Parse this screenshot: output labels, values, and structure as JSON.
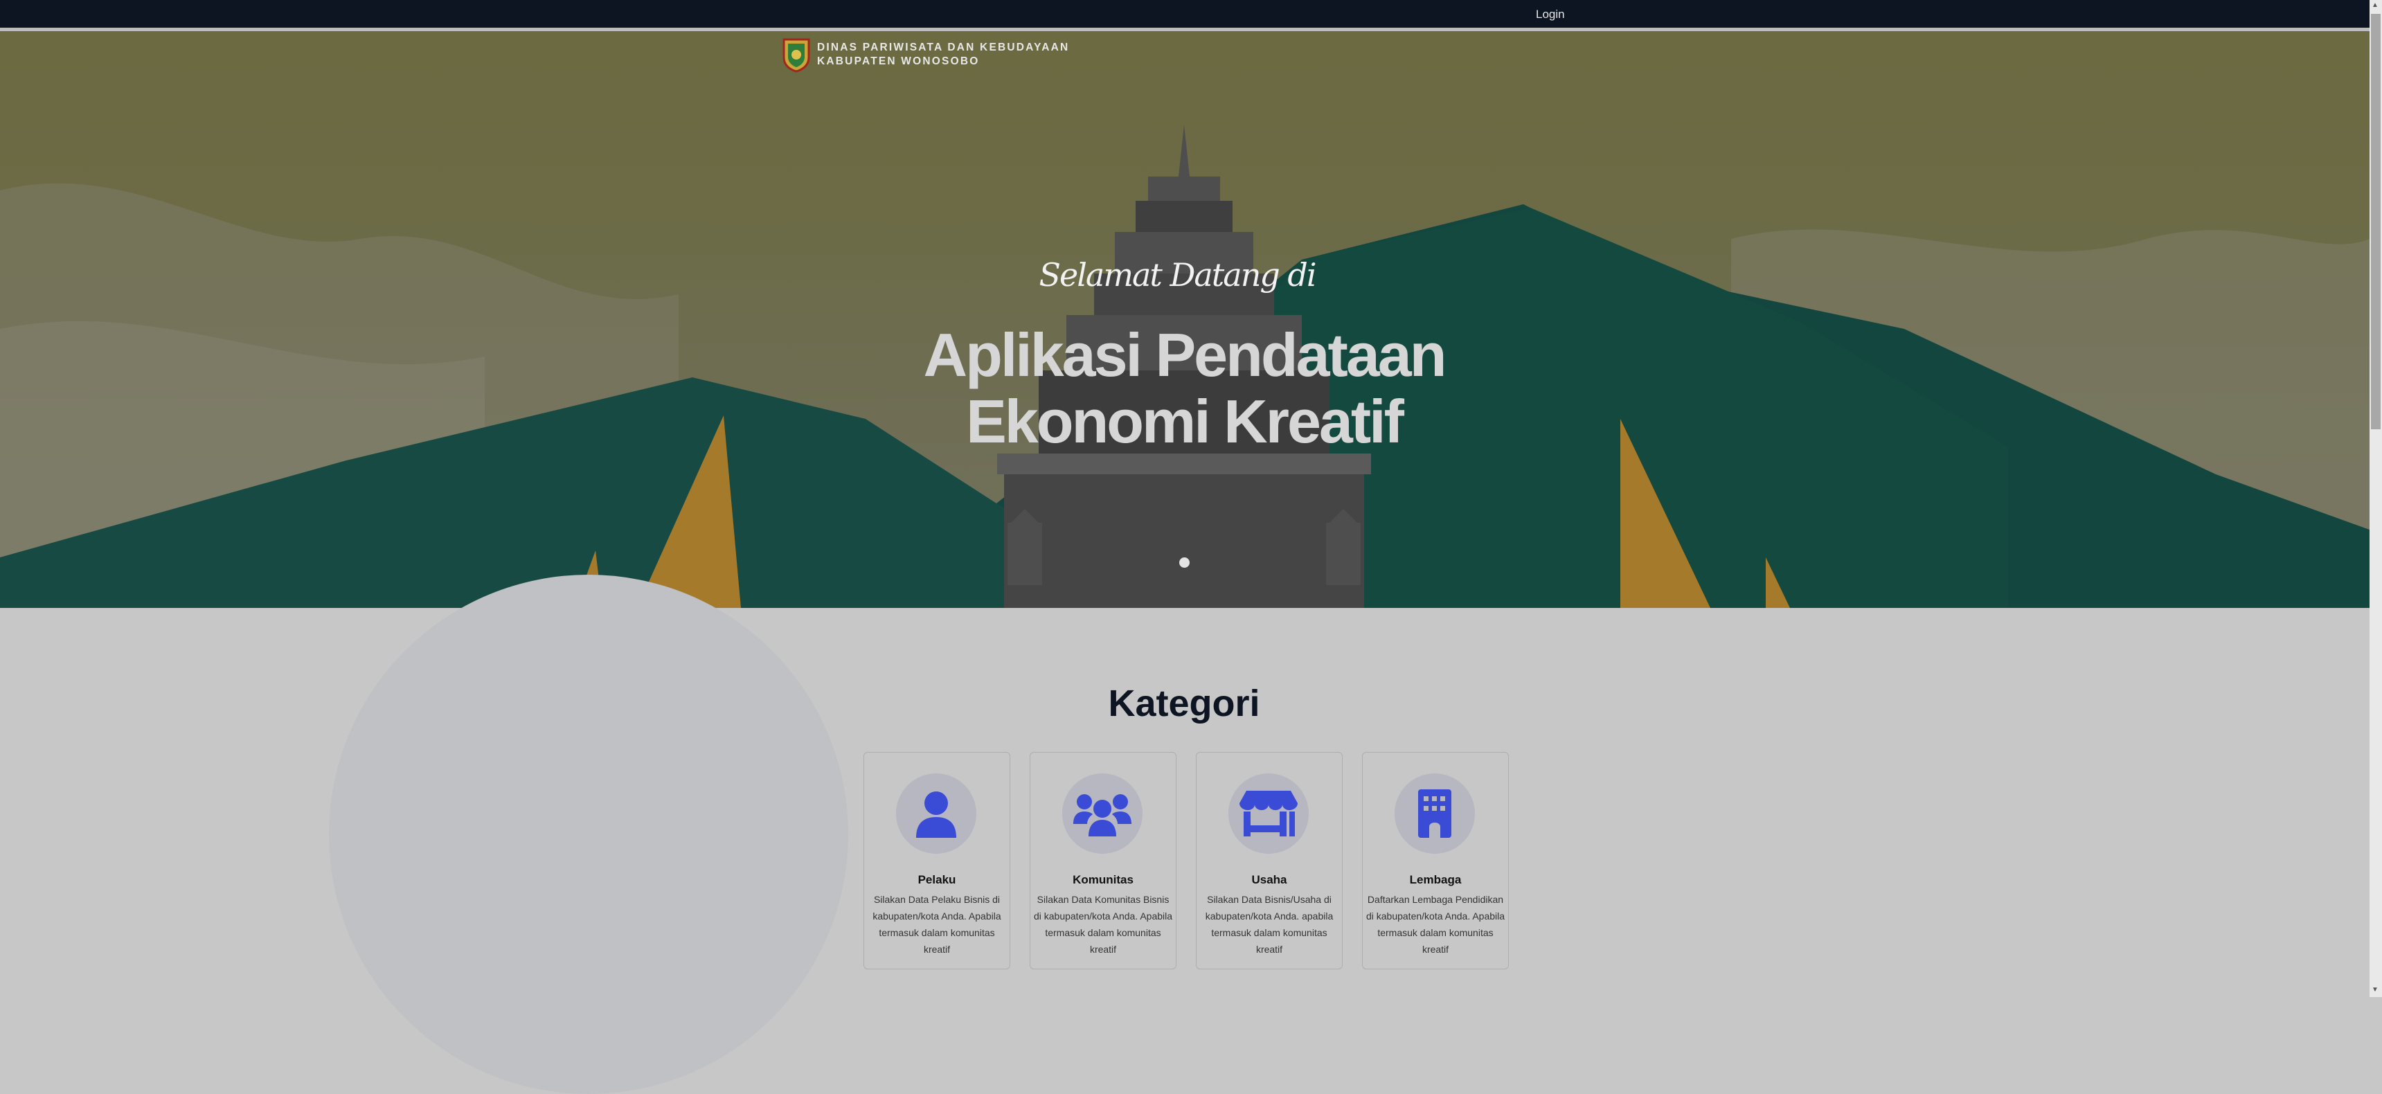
{
  "nav": {
    "login": "Login"
  },
  "brand": {
    "line1": "DINAS PARIWISATA DAN KEBUDAYAAN",
    "line2": "KABUPATEN WONOSOBO"
  },
  "hero": {
    "welcome": "Selamat Datang di",
    "title": "Aplikasi Pendataan Ekonomi Kreatif",
    "carousel": {
      "slides": 1,
      "active": 1
    }
  },
  "section": {
    "title": "Kategori"
  },
  "cards": [
    {
      "icon": "person-icon",
      "title": "Pelaku",
      "desc": "Silakan Data Pelaku Bisnis di kabupaten/kota Anda. Apabila termasuk dalam komunitas kreatif"
    },
    {
      "icon": "group-icon",
      "title": "Komunitas",
      "desc": "Silakan Data Komunitas Bisnis di kabupaten/kota Anda. Apabila termasuk dalam komunitas kreatif"
    },
    {
      "icon": "store-icon",
      "title": "Usaha",
      "desc": "Silakan Data Bisnis/Usaha di kabupaten/kota Anda. apabila termasuk dalam komunitas kreatif"
    },
    {
      "icon": "building-icon",
      "title": "Lembaga",
      "desc": "Daftarkan Lembaga Pendidikan di kabupaten/kota Anda. Apabila termasuk dalam komunitas kreatif"
    }
  ],
  "colors": {
    "accent": "#3a4bd6",
    "topbar": "#0e1522",
    "mountain": "#12463f"
  }
}
